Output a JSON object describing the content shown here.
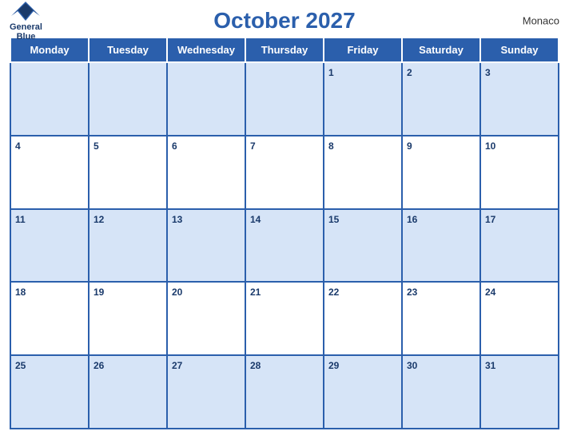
{
  "header": {
    "title": "October 2027",
    "country": "Monaco",
    "logo_line1": "General",
    "logo_line2": "Blue"
  },
  "days_of_week": [
    "Monday",
    "Tuesday",
    "Wednesday",
    "Thursday",
    "Friday",
    "Saturday",
    "Sunday"
  ],
  "weeks": [
    [
      null,
      null,
      null,
      null,
      1,
      2,
      3
    ],
    [
      4,
      5,
      6,
      7,
      8,
      9,
      10
    ],
    [
      11,
      12,
      13,
      14,
      15,
      16,
      17
    ],
    [
      18,
      19,
      20,
      21,
      22,
      23,
      24
    ],
    [
      25,
      26,
      27,
      28,
      29,
      30,
      31
    ]
  ]
}
